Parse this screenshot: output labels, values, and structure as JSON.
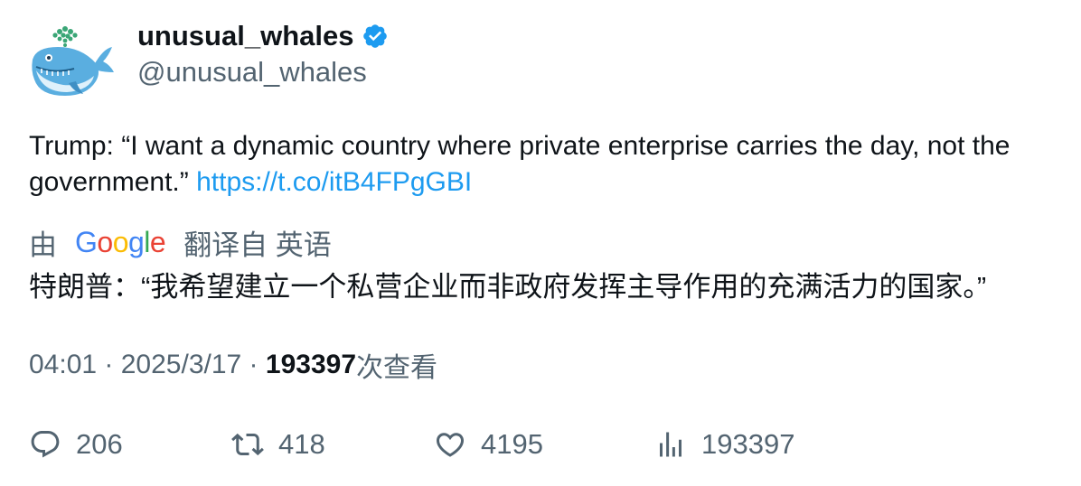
{
  "author": {
    "display_name": "unusual_whales",
    "handle": "@unusual_whales",
    "verified_icon": "verified-badge-icon",
    "avatar_icon": "whale-logo"
  },
  "tweet": {
    "text": "Trump: “I want a dynamic country where private enterprise carries the day, not the government.” ",
    "link": "https://t.co/itB4FPgGBI"
  },
  "translation": {
    "prefix": "由",
    "provider": "Google",
    "suffix": "翻译自 英语",
    "text": "特朗普：“我希望建立一个私营企业而非政府发挥主导作用的充满活力的国家。”"
  },
  "meta": {
    "time": "04:01",
    "sep1": " · ",
    "date": "2025/3/17",
    "sep2": " · ",
    "views_count": "193397",
    "views_label": "次查看"
  },
  "actions": {
    "replies": "206",
    "retweets": "418",
    "likes": "4195",
    "views": "193397"
  },
  "colors": {
    "link": "#1d9bf0",
    "secondary_text": "#536471",
    "primary_text": "#0f1419",
    "verified": "#1d9bf0"
  }
}
